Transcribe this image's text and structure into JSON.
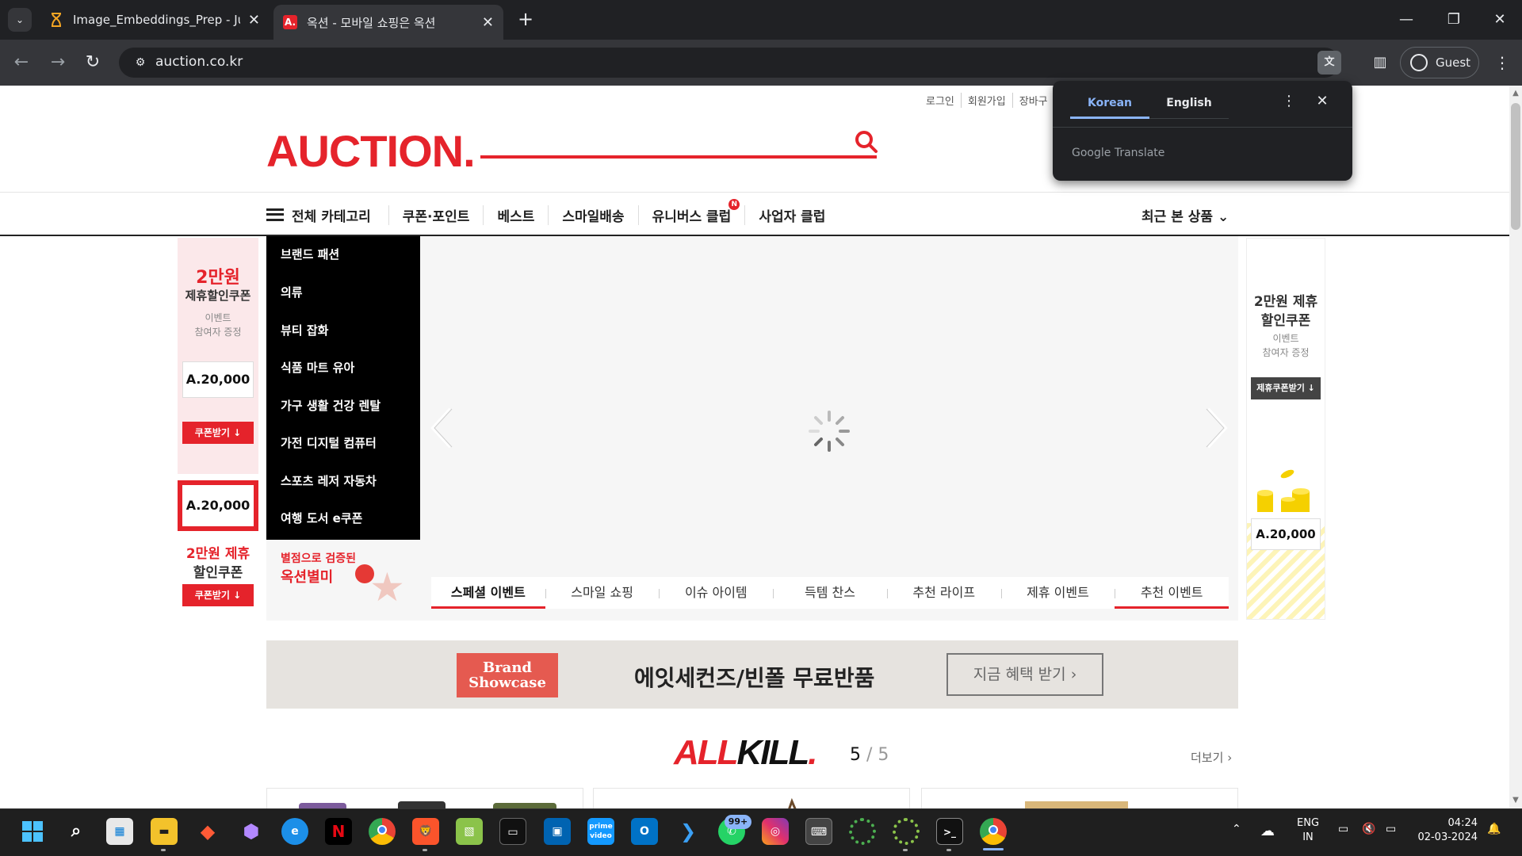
{
  "browser": {
    "tabs": [
      {
        "title": "Image_Embeddings_Prep - Jupy",
        "favicon": "hourglass-icon"
      },
      {
        "title": "옥션 - 모바일 쇼핑은 옥션",
        "favicon": "auction-a-icon"
      }
    ],
    "url": "auction.co.kr",
    "profile": "Guest"
  },
  "translate_popup": {
    "source_lang": "Korean",
    "target_lang": "English",
    "provider": "Google Translate"
  },
  "header": {
    "util_links": [
      "로그인",
      "회원가입",
      "장바구"
    ],
    "logo": "AUCTION."
  },
  "nav": {
    "all_categories": "전체 카테고리",
    "items": [
      "쿠폰·포인트",
      "베스트",
      "스마일배송",
      "유니버스 클럽",
      "사업자 클럽"
    ],
    "new_badge": "N",
    "recent": "최근 본 상품"
  },
  "categories": [
    "브랜드 패션",
    "의류",
    "뷰티 잡화",
    "식품 마트 유아",
    "가구 생활 건강 렌탈",
    "가전 디지털 컴퓨터",
    "스포츠 레저 자동차",
    "여행 도서 e쿠폰"
  ],
  "category_promo": {
    "line1": "별점으로 검증된",
    "line2": "옥션별미"
  },
  "event_tabs": [
    "스페셜 이벤트",
    "스마일 쇼핑",
    "이슈 아이템",
    "득템 찬스",
    "추천 라이프",
    "제휴 이벤트",
    "추천 이벤트"
  ],
  "left_banner": {
    "amount": "2만원",
    "title": "제휴할인쿠폰",
    "sub1": "이벤트",
    "sub2": "참여자 증정",
    "coupon_value": "A.20,000",
    "button": "쿠폰받기 ↓",
    "box2_value": "A.20,000",
    "bottom_line1": "2만원 제휴",
    "bottom_line2": "할인쿠폰",
    "button2": "쿠폰받기 ↓"
  },
  "right_banner": {
    "line1": "2만원 제휴",
    "line2": "할인쿠폰",
    "sub1": "이벤트",
    "sub2": "참여자 증정",
    "button": "제휴쿠폰받기 ↓",
    "coupon_value": "A.20,000"
  },
  "brand_showcase": {
    "badge_line1": "Brand",
    "badge_line2": "Showcase",
    "text": "에잇세컨즈/빈폴 무료반품",
    "button": "지금 혜택 받기"
  },
  "allkill": {
    "logo_a": "ALL",
    "logo_b": "KILL",
    "logo_c": ".",
    "page": "5",
    "total": "5",
    "more": "더보기"
  },
  "taskbar": {
    "badge": "99+",
    "lang_line1": "ENG",
    "lang_line2": "IN",
    "time": "04:24",
    "date": "02-03-2024"
  },
  "colors": {
    "brand_red": "#e5232b",
    "chrome_dark": "#202124",
    "translate_blue": "#8ab4f8"
  }
}
